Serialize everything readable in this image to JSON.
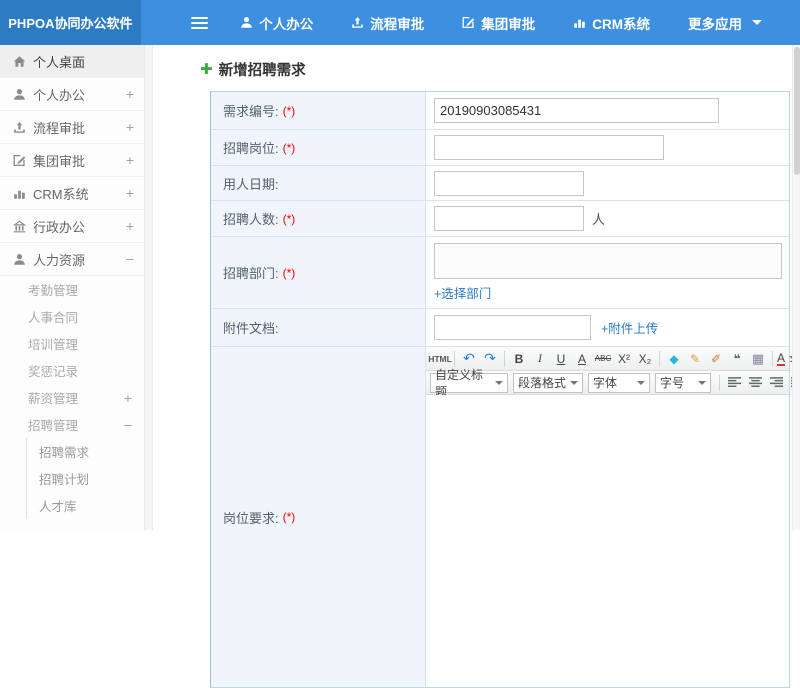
{
  "colors": {
    "navbar_bg": "#3d8fe0",
    "logo_bg": "#2d7cc3",
    "link_blue": "#2a7bc5",
    "required_red": "#ee0000",
    "title_plus_green": "#3aaa3a",
    "undo_redo_blue": "#2d7dd2"
  },
  "navbar": {
    "logo": "PHPOA协同办公软件",
    "items": [
      {
        "label": "个人办公",
        "icon": "person-icon"
      },
      {
        "label": "流程审批",
        "icon": "flow-icon"
      },
      {
        "label": "集团审批",
        "icon": "edit-icon"
      },
      {
        "label": "CRM系统",
        "icon": "chart-icon"
      },
      {
        "label": "更多应用",
        "icon": "chevron-down-icon"
      }
    ]
  },
  "sidebar": {
    "items": [
      {
        "label": "个人桌面",
        "icon": "home-icon",
        "expand": "",
        "active": true
      },
      {
        "label": "个人办公",
        "icon": "person-icon",
        "expand": "+"
      },
      {
        "label": "流程审批",
        "icon": "flow-icon",
        "expand": "+"
      },
      {
        "label": "集团审批",
        "icon": "edit-icon",
        "expand": "+"
      },
      {
        "label": "CRM系统",
        "icon": "chart-icon",
        "expand": "+"
      },
      {
        "label": "行政办公",
        "icon": "building-icon",
        "expand": "+"
      },
      {
        "label": "人力资源",
        "icon": "people-icon",
        "expand": "−"
      }
    ],
    "hr_children": [
      {
        "label": "考勤管理",
        "expand": ""
      },
      {
        "label": "人事合同",
        "expand": ""
      },
      {
        "label": "培训管理",
        "expand": ""
      },
      {
        "label": "奖惩记录",
        "expand": ""
      },
      {
        "label": "薪资管理",
        "expand": "+"
      },
      {
        "label": "招聘管理",
        "expand": "−"
      }
    ],
    "recruit_children": [
      {
        "label": "招聘需求"
      },
      {
        "label": "招聘计划"
      },
      {
        "label": "人才库"
      }
    ]
  },
  "content": {
    "title": "新增招聘需求",
    "title_icon_glyph": "✚"
  },
  "form": {
    "rows": [
      {
        "label": "需求编号:",
        "required": "(*)",
        "value": "20190903085431"
      },
      {
        "label": "招聘岗位:",
        "required": "(*)",
        "value": ""
      },
      {
        "label": "用人日期:",
        "required": "",
        "value": ""
      },
      {
        "label": "招聘人数:",
        "required": "(*)",
        "value": "",
        "suffix": "人"
      },
      {
        "label": "招聘部门:",
        "required": "(*)",
        "value": "",
        "link": "+选择部门"
      },
      {
        "label": "附件文档:",
        "required": "",
        "value": "",
        "link": "+附件上传"
      },
      {
        "label": "岗位要求:",
        "required": "(*)"
      }
    ]
  },
  "editor": {
    "buttons_row1": [
      "HTML",
      "↶",
      "↷",
      "B",
      "I",
      "U",
      "A",
      "ABC",
      "X²",
      "X₂",
      "◆",
      "✎",
      "✐",
      "❝",
      "▦",
      "A"
    ],
    "selects_row2": [
      "自定义标题",
      "段落格式",
      "字体",
      "字号"
    ],
    "align_icons": [
      "align-left-icon",
      "align-center-icon",
      "align-right-icon",
      "align-justify-icon"
    ]
  }
}
